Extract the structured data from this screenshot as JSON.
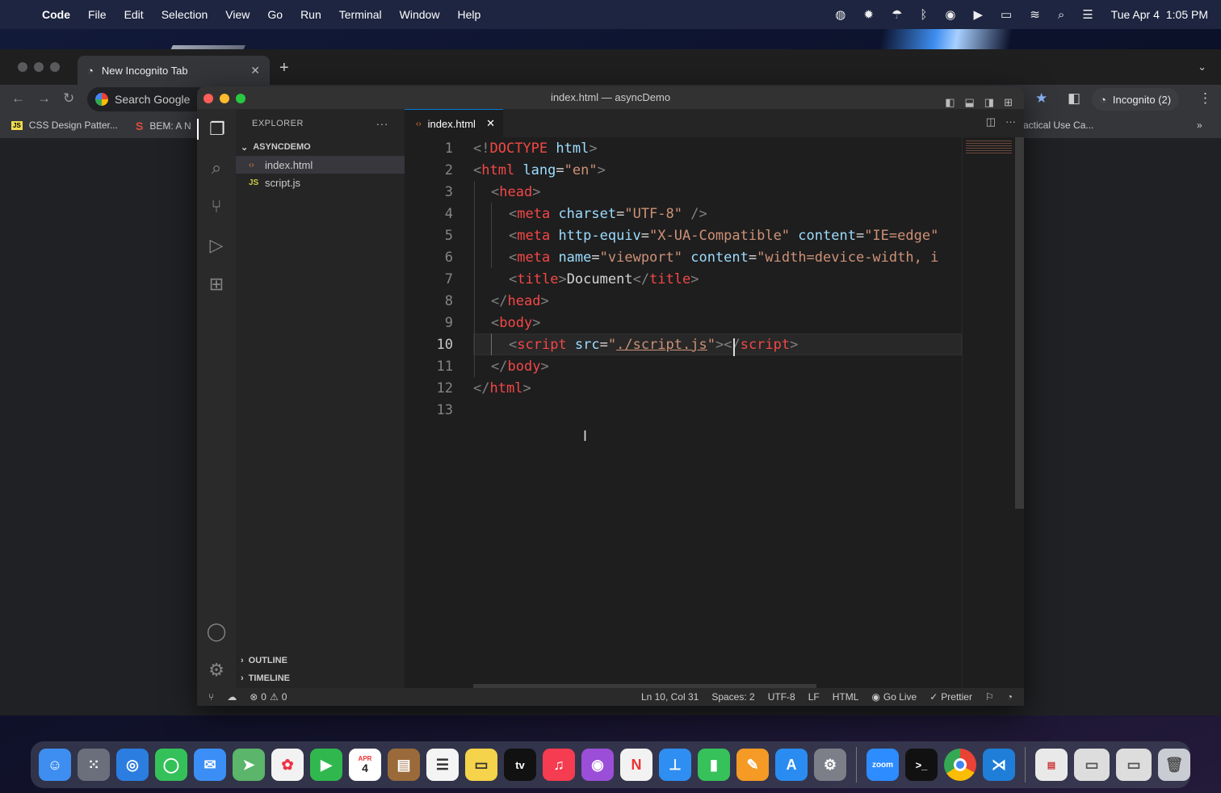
{
  "menubar": {
    "app": "Code",
    "items": [
      "File",
      "Edit",
      "Selection",
      "View",
      "Go",
      "Run",
      "Terminal",
      "Window",
      "Help"
    ],
    "date": "Tue Apr 4",
    "time": "1:05 PM"
  },
  "chrome": {
    "tab_title": "New Incognito Tab",
    "omnibox": "Search Google",
    "profile": "Incognito (2)",
    "bookmarks": [
      "CSS Design Patter...",
      "BEM: A N",
      "actical Use Ca..."
    ]
  },
  "vscode": {
    "window_title": "index.html — asyncDemo",
    "explorer_title": "EXPLORER",
    "folder": "ASYNCDEMO",
    "files": [
      "index.html",
      "script.js"
    ],
    "outline": "OUTLINE",
    "timeline": "TIMELINE",
    "tab": "index.html",
    "line_numbers": [
      "1",
      "2",
      "3",
      "4",
      "5",
      "6",
      "7",
      "8",
      "9",
      "10",
      "11",
      "12",
      "13"
    ],
    "status": {
      "errors": "0",
      "warnings": "0",
      "position": "Ln 10, Col 31",
      "spaces": "Spaces: 2",
      "encoding": "UTF-8",
      "eol": "LF",
      "language": "HTML",
      "golive": "Go Live",
      "prettier": "Prettier"
    }
  },
  "code_text": {
    "l1": [
      "<!",
      "DOCTYPE",
      " html",
      ">"
    ],
    "l2": [
      "<",
      "html",
      " lang",
      "=",
      "\"en\"",
      ">"
    ],
    "l3": [
      "<",
      "head",
      ">"
    ],
    "l4": [
      "<",
      "meta",
      " charset",
      "=",
      "\"UTF-8\"",
      " />"
    ],
    "l5": [
      "<",
      "meta",
      " http-equiv",
      "=",
      "\"X-UA-Compatible\"",
      " content",
      "=",
      "\"IE=edge\""
    ],
    "l6": [
      "<",
      "meta",
      " name",
      "=",
      "\"viewport\"",
      " content",
      "=",
      "\"width=device-width, i"
    ],
    "l7": [
      "<",
      "title",
      ">",
      "Document",
      "</",
      "title",
      ">"
    ],
    "l8": [
      "</",
      "head",
      ">"
    ],
    "l9": [
      "<",
      "body",
      ">"
    ],
    "l10": [
      "<",
      "script",
      " src",
      "=",
      "\"",
      "./script.js",
      "\"",
      ">",
      "</",
      "script",
      ">"
    ],
    "l11": [
      "</",
      "body",
      ">"
    ],
    "l12": [
      "</",
      "html",
      ">"
    ]
  },
  "dock": {
    "zoom_label": "zoom",
    "calendar_month": "APR",
    "calendar_day": "4",
    "tv_label": "tv"
  },
  "colors": {
    "accent": "#0078d4",
    "tag": "#569cd6",
    "string": "#ce9178",
    "attr": "#9cdcfe"
  }
}
